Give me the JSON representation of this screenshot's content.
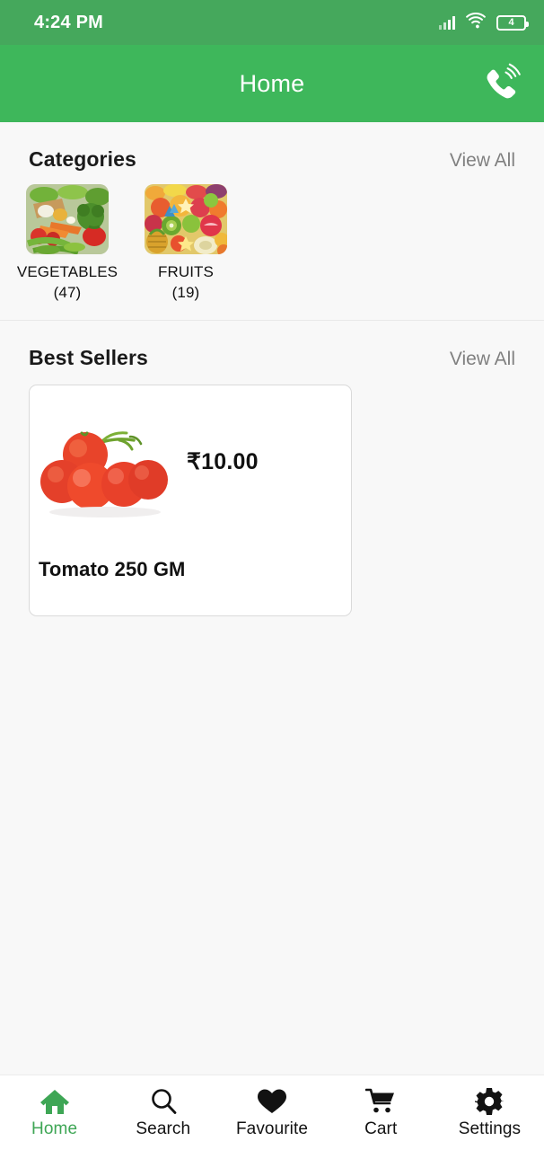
{
  "status_bar": {
    "time": "4:24 PM",
    "battery_level": "4",
    "signal_icon": "signal-bars-icon",
    "wifi_icon": "wifi-icon",
    "battery_icon": "battery-icon",
    "background_color": "#45a85c"
  },
  "app_bar": {
    "title": "Home",
    "call_icon": "phone-ringing-icon",
    "background_color": "#3eb75b"
  },
  "categories": {
    "title": "Categories",
    "view_all_label": "View All",
    "items": [
      {
        "name": "VEGETABLES",
        "count": "(47)",
        "image": "vegetables-photo"
      },
      {
        "name": "FRUITS",
        "count": "(19)",
        "image": "fruits-photo"
      }
    ]
  },
  "best_sellers": {
    "title": "Best Sellers",
    "view_all_label": "View All",
    "items": [
      {
        "name": "Tomato 250 GM",
        "price": "₹10.00",
        "image": "tomatoes-photo"
      }
    ]
  },
  "bottom_nav": {
    "active_color": "#3ea655",
    "items": [
      {
        "label": "Home",
        "icon": "home-icon",
        "active": true
      },
      {
        "label": "Search",
        "icon": "search-icon",
        "active": false
      },
      {
        "label": "Favourite",
        "icon": "heart-icon",
        "active": false
      },
      {
        "label": "Cart",
        "icon": "shopping-cart-icon",
        "active": false
      },
      {
        "label": "Settings",
        "icon": "gear-icon",
        "active": false
      }
    ]
  }
}
